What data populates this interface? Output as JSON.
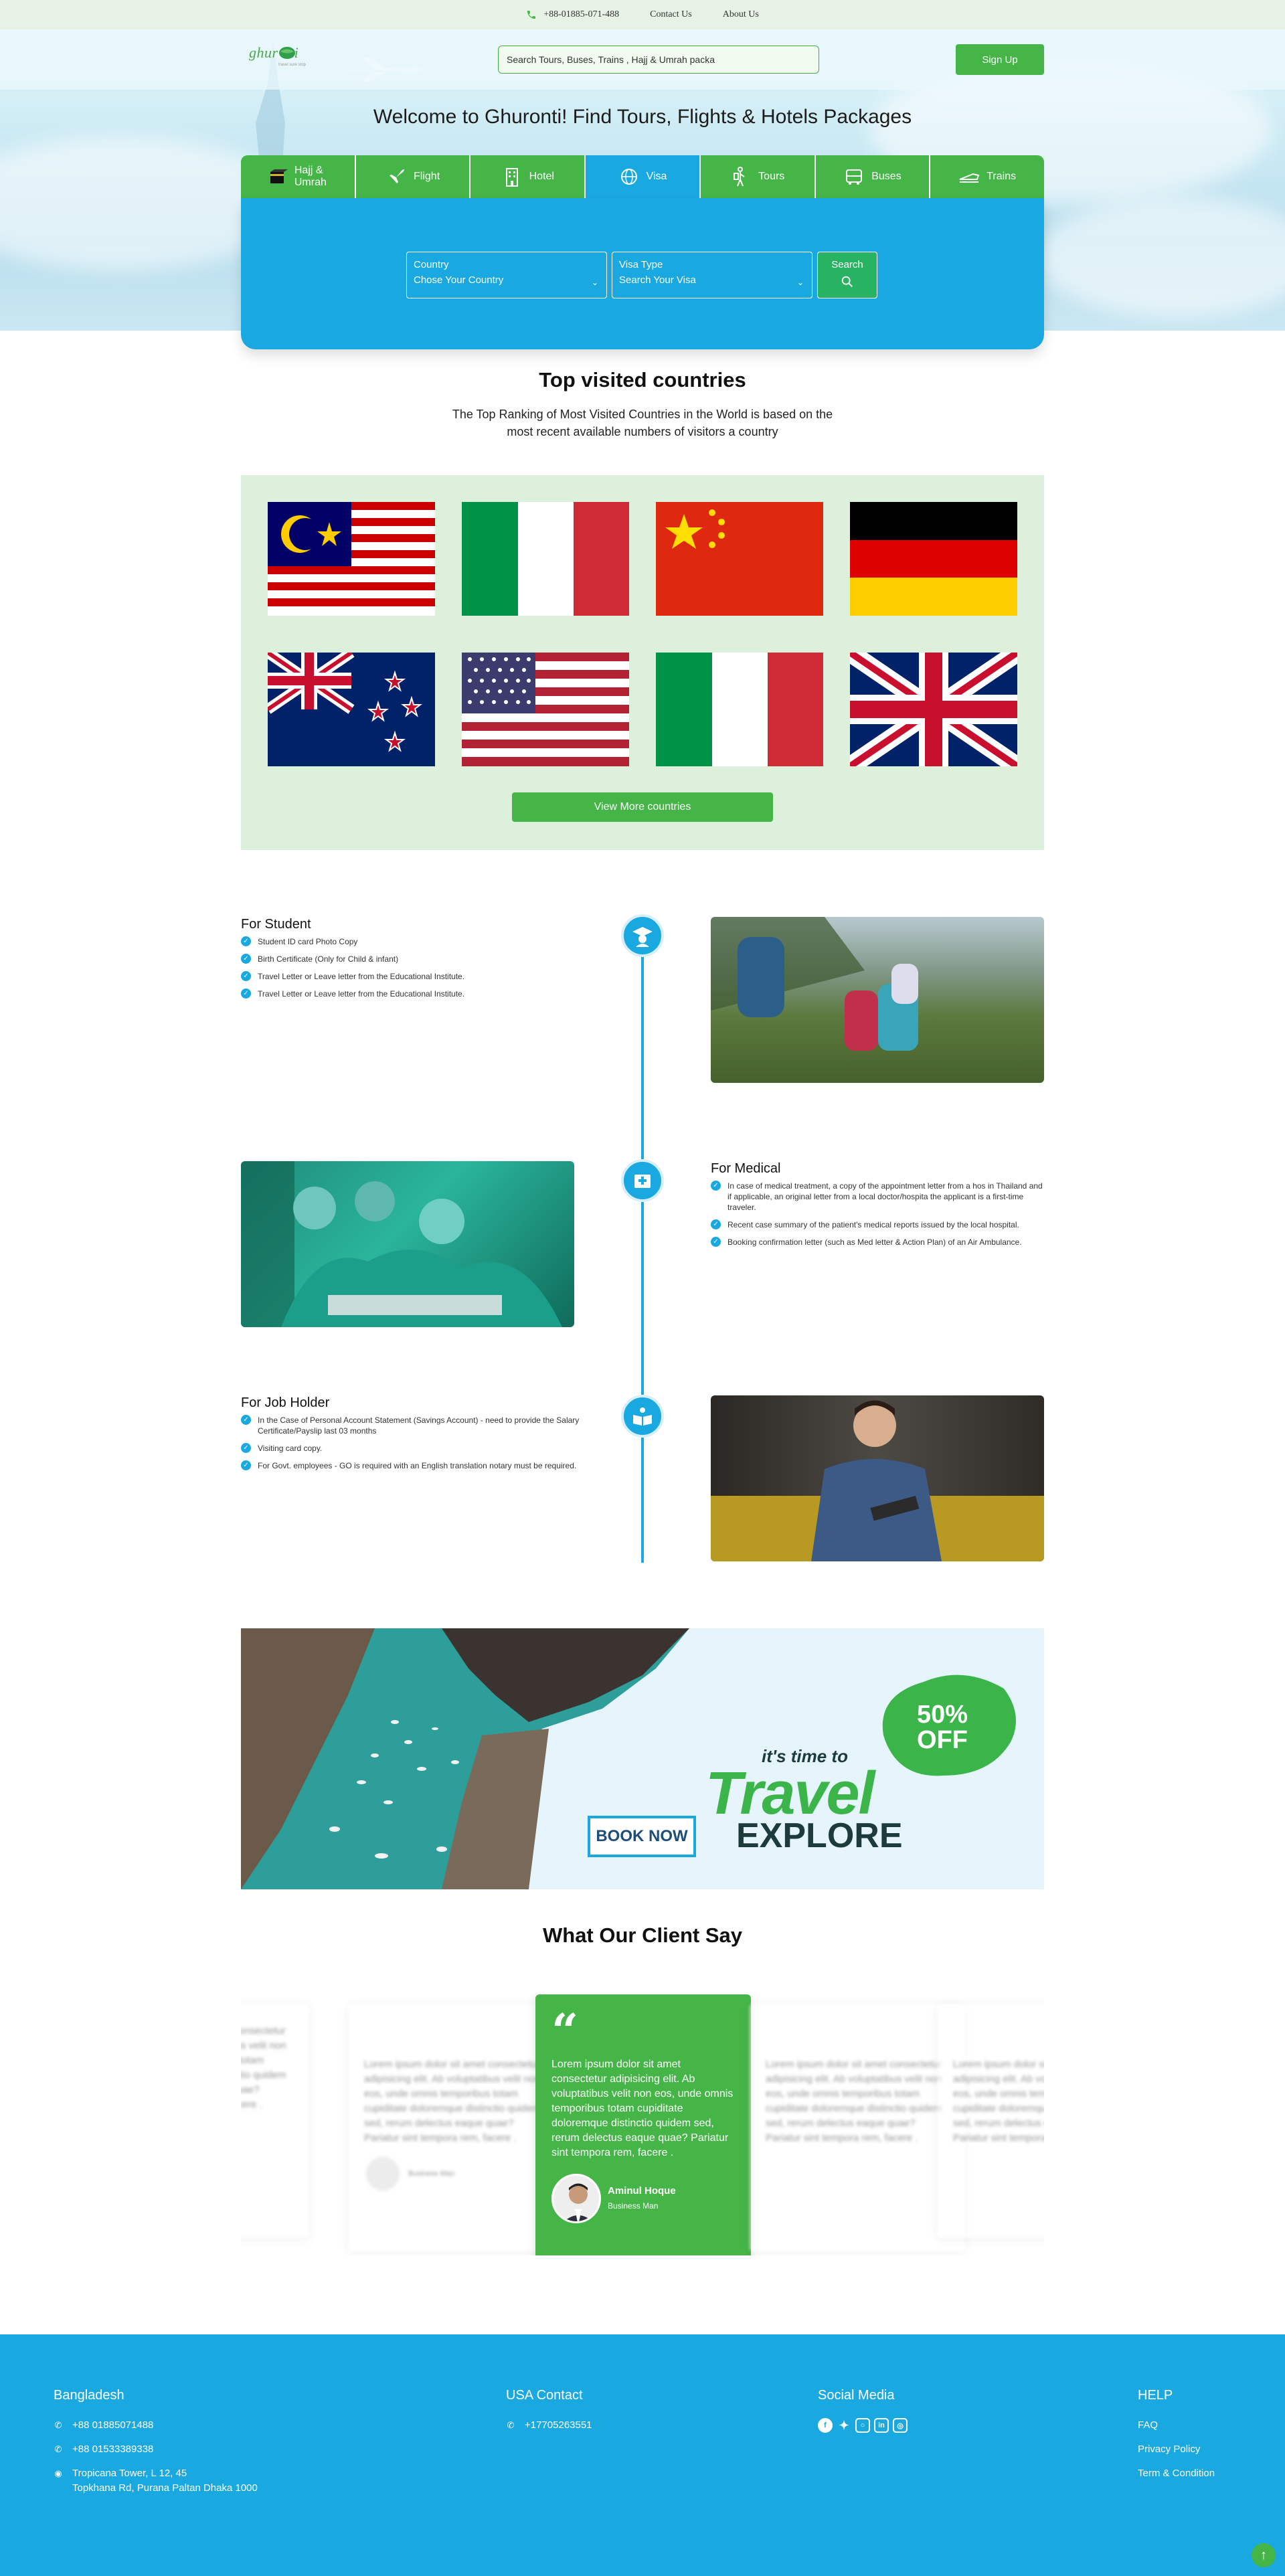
{
  "topbar": {
    "phone": "+88-01885-071-488",
    "contact": "Contact Us",
    "about": "About Us"
  },
  "header": {
    "logo_text": "ghur nti",
    "logo_tagline": "travel sure stop",
    "search_placeholder": "Search Tours, Buses, Trains , Hajj & Umrah packa",
    "signup": "Sign Up"
  },
  "hero": {
    "welcome": "Welcome to Ghuronti! Find Tours, Flights & Hotels Packages"
  },
  "tabs": [
    {
      "label": "Hajj & Umrah",
      "icon": "kaaba-icon",
      "active": false
    },
    {
      "label": "Flight",
      "icon": "plane-icon",
      "active": false
    },
    {
      "label": "Hotel",
      "icon": "building-icon",
      "active": false
    },
    {
      "label": "Visa",
      "icon": "globe-icon",
      "active": true
    },
    {
      "label": "Tours",
      "icon": "traveler-icon",
      "active": false
    },
    {
      "label": "Buses",
      "icon": "bus-icon",
      "active": false
    },
    {
      "label": "Trains",
      "icon": "train-icon",
      "active": false
    }
  ],
  "visa_search": {
    "country_label": "Country",
    "country_value": "Chose Your Country",
    "type_label": "Visa Type",
    "type_value": "Search Your Visa",
    "search_label": "Search"
  },
  "top_countries": {
    "title": "Top visited countries",
    "subtitle_line1": "The Top Ranking of Most Visited Countries in the World is based on the",
    "subtitle_line2": "most recent available numbers of visitors a country",
    "flags": [
      "malaysia-flag",
      "italy-flag",
      "china-flag",
      "germany-flag",
      "new-zealand-flag",
      "usa-flag",
      "italy-flag",
      "uk-flag"
    ],
    "more_button": "View More countries"
  },
  "requirements": [
    {
      "title": "For Student",
      "icon": "graduate-icon",
      "items": [
        "Student ID card Photo Copy",
        "Birth Certificate (Only for Child & infant)",
        "Travel Letter or Leave letter from the Educational Institute.",
        "Travel Letter or Leave letter from the Educational Institute."
      ]
    },
    {
      "title": "For Medical",
      "icon": "medical-kit-icon",
      "items": [
        "In case of medical treatment, a copy of the appointment letter from a hos in Thailand and if applicable, an original letter from a local doctor/hospita the applicant is a first-time traveler.",
        "Recent case summary of the patient's medical reports issued by the local hospital.",
        "Booking confirmation letter (such as Med letter & Action Plan) of an Air Ambulance."
      ]
    },
    {
      "title": "For Job Holder",
      "icon": "book-reader-icon",
      "items": [
        "In the Case of Personal Account Statement (Savings Account) - need to provide the Salary Certificate/Payslip last 03 months",
        "Visiting card copy.",
        "For Govt. employees - GO is required with an English translation notary must be required."
      ]
    }
  ],
  "banner": {
    "tagline": "it's time to",
    "big": "Travel",
    "explore": "EXPLORE",
    "book": "BOOK NOW",
    "discount": "50%",
    "off": "OFF"
  },
  "testimonials": {
    "title": "What Our Client Say",
    "quote": "Lorem ipsum dolor sit amet consectetur adipisicing elit. Ab voluptatibus velit non eos, unde omnis temporibus totam cupiditate doloremque distinctio quidem sed, rerum delectus eaque quae? Pariatur sint tempora rem, facere .",
    "name": "Aminul Hoque",
    "role": "Business Man",
    "blur_text": "Lorem ipsum dolor sit amet consectetur adipisicing elit. Ab voluptatibus velit non eos, unde omnis temporibus totam cupiditate doloremque distinctio quidem sed, rerum delectus eaque quae? Pariatur sint tempora rem, facere .",
    "blur_role": "Business Man"
  },
  "footer": {
    "bd": {
      "title": "Bangladesh",
      "phone1": "+88 01885071488",
      "phone2": "+88 01533389338",
      "addr1": "Tropicana Tower, L 12, 45",
      "addr2": "Topkhana Rd, Purana Paltan Dhaka 1000"
    },
    "usa": {
      "title": "USA Contact",
      "phone": "+17705263551"
    },
    "social": {
      "title": "Social Media",
      "icons": [
        "facebook-icon",
        "twitter-icon",
        "instagram-icon",
        "linkedin-icon",
        "instagram-alt-icon"
      ]
    },
    "help": {
      "title": "HELP",
      "faq": "FAQ",
      "privacy": "Privacy Policy",
      "terms": "Term & Condition"
    }
  },
  "colors": {
    "green": "#45b548",
    "blue": "#1aa8e0",
    "flag_bg": "#ddf0dc"
  }
}
